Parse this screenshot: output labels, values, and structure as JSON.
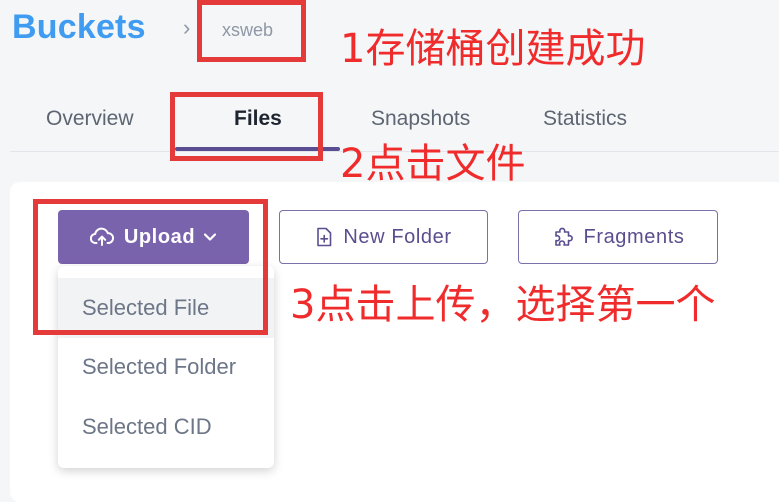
{
  "header": {
    "title": "Buckets",
    "separator": "›",
    "bucket_name": "xsweb"
  },
  "tabs": [
    {
      "label": "Overview",
      "active": false
    },
    {
      "label": "Files",
      "active": true
    },
    {
      "label": "Snapshots",
      "active": false
    },
    {
      "label": "Statistics",
      "active": false
    }
  ],
  "toolbar": {
    "upload_label": "Upload",
    "new_folder_label": "New Folder",
    "fragments_label": "Fragments"
  },
  "upload_menu": {
    "items": [
      "Selected File",
      "Selected Folder",
      "Selected CID"
    ]
  },
  "annotations": {
    "step1": "1存储桶创建成功",
    "step2": "2点击文件",
    "step3": "3点击上传，选择第一个"
  },
  "colors": {
    "brand_blue": "#3f9cf1",
    "primary_purple": "#7a63ad",
    "annotation_red": "#e53a3a"
  },
  "icons": {
    "upload": "cloud-upload-icon",
    "upload_caret": "chevron-down-icon",
    "new_folder": "file-plus-icon",
    "fragments": "puzzle-icon"
  }
}
